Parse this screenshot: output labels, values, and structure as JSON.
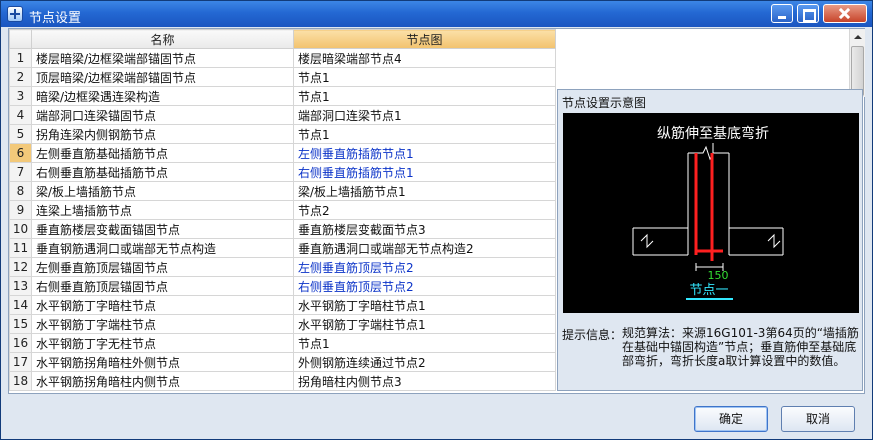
{
  "window": {
    "title": "节点设置"
  },
  "table": {
    "headers": [
      "名称",
      "节点图"
    ],
    "rows": [
      {
        "num": "1",
        "name": "楼层暗梁/边框梁端部锚固节点",
        "node": "楼层暗梁端部节点4",
        "blue": false
      },
      {
        "num": "2",
        "name": "顶层暗梁/边框梁端部锚固节点",
        "node": "节点1",
        "blue": false
      },
      {
        "num": "3",
        "name": "暗梁/边框梁遇连梁构造",
        "node": "节点1",
        "blue": false
      },
      {
        "num": "4",
        "name": "端部洞口连梁锚固节点",
        "node": "端部洞口连梁节点1",
        "blue": false
      },
      {
        "num": "5",
        "name": "拐角连梁内侧钢筋节点",
        "node": "节点1",
        "blue": false
      },
      {
        "num": "6",
        "name": "左侧垂直筋基础插筋节点",
        "node": "左侧垂直筋插筋节点1",
        "blue": true,
        "selected": true
      },
      {
        "num": "7",
        "name": "右侧垂直筋基础插筋节点",
        "node": "右侧垂直筋插筋节点1",
        "blue": true
      },
      {
        "num": "8",
        "name": "梁/板上墙插筋节点",
        "node": "梁/板上墙插筋节点1",
        "blue": false
      },
      {
        "num": "9",
        "name": "连梁上墙插筋节点",
        "node": "节点2",
        "blue": false
      },
      {
        "num": "10",
        "name": "垂直筋楼层变截面锚固节点",
        "node": "垂直筋楼层变截面节点3",
        "blue": false
      },
      {
        "num": "11",
        "name": "垂直钢筋遇洞口或端部无节点构造",
        "node": "垂直筋遇洞口或端部无节点构造2",
        "blue": false
      },
      {
        "num": "12",
        "name": "左侧垂直筋顶层锚固节点",
        "node": "左侧垂直筋顶层节点2",
        "blue": true
      },
      {
        "num": "13",
        "name": "右侧垂直筋顶层锚固节点",
        "node": "右侧垂直筋顶层节点2",
        "blue": true
      },
      {
        "num": "14",
        "name": "水平钢筋丁字暗柱节点",
        "node": "水平钢筋丁字暗柱节点1",
        "blue": false
      },
      {
        "num": "15",
        "name": "水平钢筋丁字端柱节点",
        "node": "水平钢筋丁字端柱节点1",
        "blue": false
      },
      {
        "num": "16",
        "name": "水平钢筋丁字无柱节点",
        "node": "节点1",
        "blue": false
      },
      {
        "num": "17",
        "name": "水平钢筋拐角暗柱外侧节点",
        "node": "外侧钢筋连续通过节点2",
        "blue": false
      },
      {
        "num": "18",
        "name": "水平钢筋拐角暗柱内侧节点",
        "node": "拐角暗柱内侧节点3",
        "blue": false
      }
    ]
  },
  "preview": {
    "title": "节点设置示意图",
    "diagram_caption": "纵筋伸至基底弯折",
    "dimension": "150",
    "node_label": "节点一",
    "info_label": "提示信息：",
    "info_text": "规范算法：来源16G101-3第64页的“墙插筋在基础中锚固构造”节点；垂直筋伸至基础底部弯折，弯折长度a取计算设置中的数值。"
  },
  "buttons": {
    "ok": "确定",
    "cancel": "取消"
  },
  "colors": {
    "selected_row_number": "#f3c97a",
    "node_header": "#f2c26e",
    "blue_text": "#0b33c8",
    "rebar_red": "#ff2020",
    "dimension_green": "#33dd33",
    "label_cyan": "#33e8ff"
  }
}
